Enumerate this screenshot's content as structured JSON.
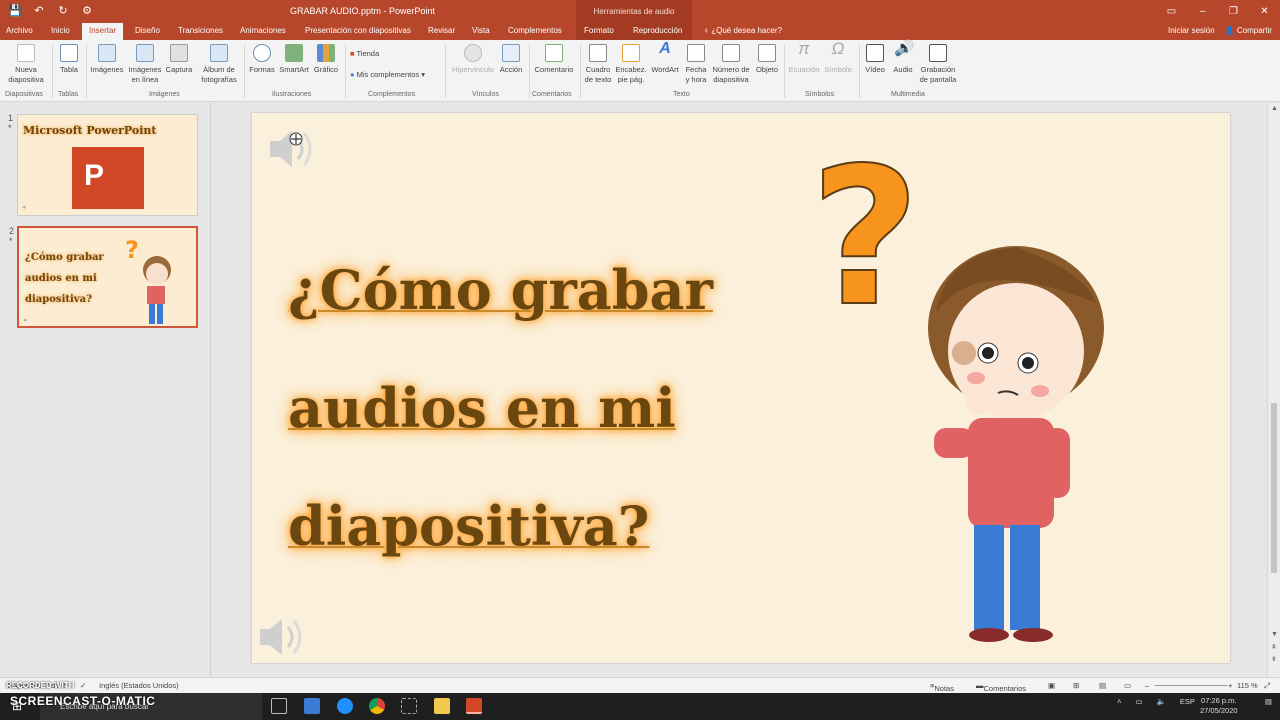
{
  "app": {
    "title": "GRABAR AUDIO.pptm - PowerPoint",
    "context_group": "Herramientas de audio",
    "qat": {
      "save": "💾",
      "undo": "↶",
      "redo": "↻",
      "misc": "⚙"
    }
  },
  "tabs": [
    "Archivo",
    "Inicio",
    "Insertar",
    "Diseño",
    "Transiciones",
    "Animaciones",
    "Presentación con diapositivas",
    "Revisar",
    "Vista",
    "Complementos",
    "Formato",
    "Reproducción"
  ],
  "active_tab": "Insertar",
  "tellme": "¿Qué desea hacer?",
  "signin": "Iniciar sesión",
  "share": "Compartir",
  "ribbon": {
    "buttons": {
      "nueva": "Nueva diapositiva",
      "tabla": "Tabla",
      "imagenes": "Imágenes",
      "imagenes_linea": "Imágenes en línea",
      "captura": "Captura",
      "album": "Álbum de fotografías",
      "formas": "Formas",
      "smartart": "SmartArt",
      "grafico": "Gráfico",
      "tienda": "Tienda",
      "mis_complementos": "Mis complementos",
      "hipervinculo": "Hipervínculo",
      "accion": "Acción",
      "comentario": "Comentario",
      "cuadro": "Cuadro de texto",
      "encabez": "Encabez. pie pág.",
      "wordart": "WordArt",
      "fecha": "Fecha y hora",
      "numero": "Número de diapositiva",
      "objeto": "Objeto",
      "ecuacion": "Ecuación",
      "simbolo": "Símbolo",
      "video": "Vídeo",
      "audio": "Audio",
      "grabacion": "Grabación de pantalla"
    },
    "groups": {
      "diapositivas": "Diapositivas",
      "tablas": "Tablas",
      "imagenes": "Imágenes",
      "ilustraciones": "Ilustraciones",
      "complementos": "Complementos",
      "vinculos": "Vínculos",
      "comentarios": "Comentarios",
      "texto": "Texto",
      "simbolos": "Símbolos",
      "multimedia": "Multimedia"
    }
  },
  "thumbnails": [
    {
      "num": "1",
      "star": "*",
      "title": "Microsoft PowerPoint",
      "logo": "P"
    },
    {
      "num": "2",
      "star": "*",
      "title": "¿Cómo grabar audios en mi diapositiva?"
    }
  ],
  "slide": {
    "title": "¿Cómo grabar audios en mi diapositiva?",
    "question_mark": "?"
  },
  "status": {
    "slide": "Diapositiva 2 de 2",
    "language": "Inglés (Estados Unidos)",
    "notes": "Notas",
    "comments": "Comentarios",
    "zoom": "115 %"
  },
  "taskbar": {
    "search": "Escribe aquí para buscar",
    "lang": "ESP",
    "time": "07:26 p.m.",
    "date": "27/05/2020"
  },
  "watermark": {
    "line1": "RECORDED WITH",
    "line2": "SCREENCAST-O-MATIC"
  },
  "colors": {
    "accent": "#b7472a",
    "slide_bg": "#fbf0dc",
    "glow": "#ff9d2a"
  }
}
